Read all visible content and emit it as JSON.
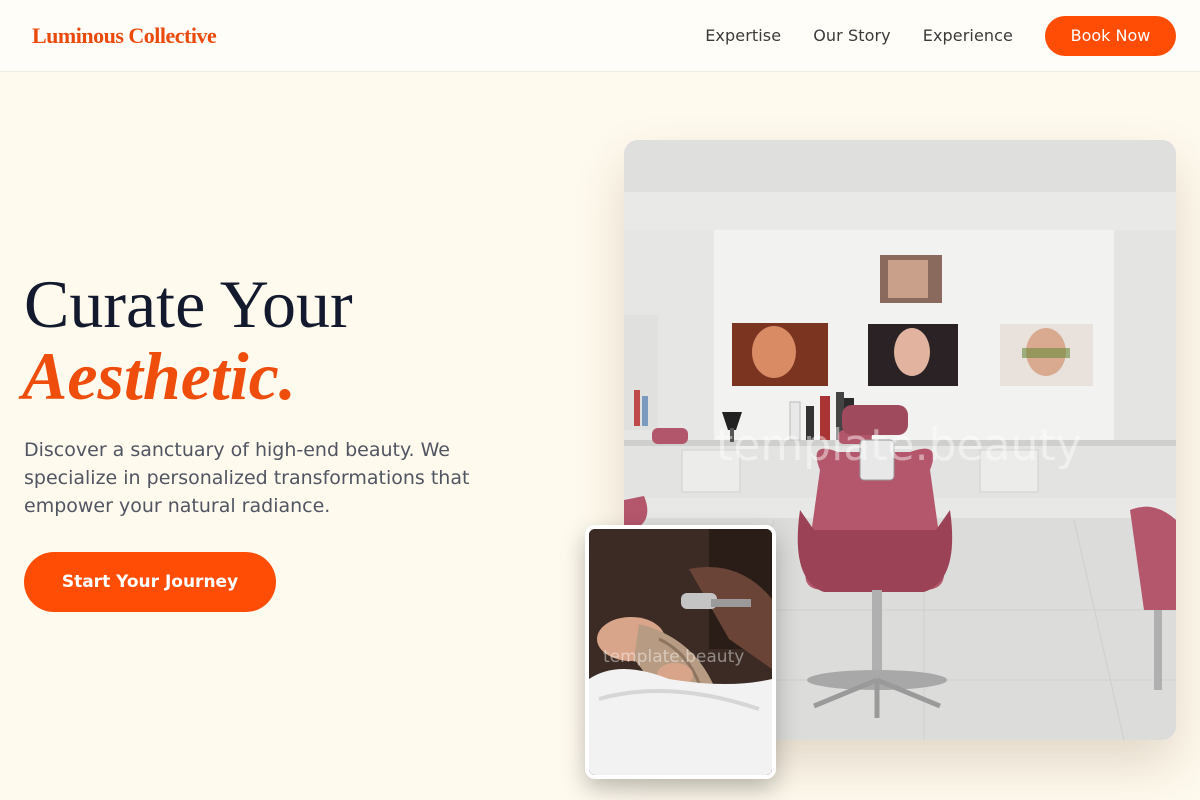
{
  "brand": {
    "name": "Luminous Collective"
  },
  "nav": {
    "items": [
      "Expertise",
      "Our Story",
      "Experience"
    ],
    "cta_label": "Book Now"
  },
  "hero": {
    "headline_line1": "Curate Your",
    "headline_line2": "Aesthetic.",
    "description": "Discover a sanctuary of high-end beauty. We specialize in personalized transformations that empower your natural radiance.",
    "cta_label": "Start Your Journey"
  },
  "images": {
    "main_watermark": "template.beauty",
    "inset_watermark": "template.beauty"
  },
  "colors": {
    "accent": "#ff4d06",
    "background": "#fffaee",
    "heading": "#141a2e"
  }
}
